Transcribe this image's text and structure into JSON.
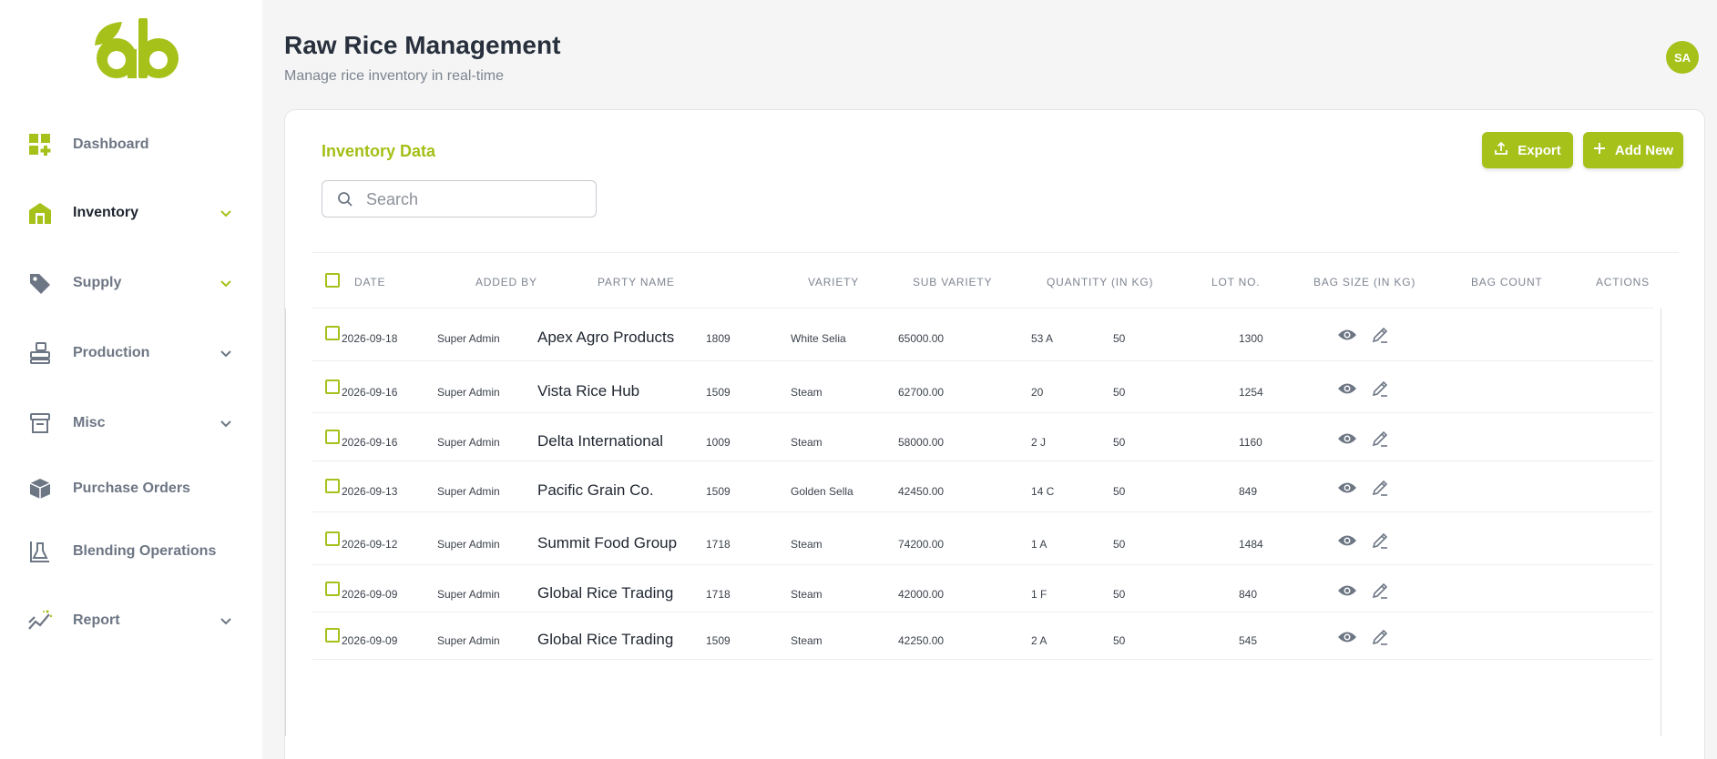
{
  "colors": {
    "accent": "#a6c11a",
    "accent_text": "#a4bf17",
    "sidebar_bg": "#ffffff",
    "page_bg": "#f5f5f5"
  },
  "sidebar": {
    "logo_text": "ab",
    "items": [
      {
        "label": "Dashboard",
        "icon": "dashboard-icon",
        "has_chevron": false
      },
      {
        "label": "Inventory",
        "icon": "warehouse-icon",
        "has_chevron": true,
        "active": true
      },
      {
        "label": "Supply",
        "icon": "tag-icon",
        "has_chevron": true
      },
      {
        "label": "Production",
        "icon": "machine-icon",
        "has_chevron": true
      },
      {
        "label": "Misc",
        "icon": "box-icon",
        "has_chevron": true
      },
      {
        "label": "Purchase Orders",
        "icon": "cube-icon",
        "has_chevron": false
      },
      {
        "label": "Blending Operations",
        "icon": "flask-icon",
        "has_chevron": false
      },
      {
        "label": "Report",
        "icon": "chart-icon",
        "has_chevron": true
      }
    ]
  },
  "header": {
    "title": "Raw Rice Management",
    "subtitle": "Manage rice inventory in real-time",
    "avatar_initials": "SA"
  },
  "card": {
    "title": "Inventory Data",
    "search_placeholder": "Search",
    "search_value": "",
    "export_label": "Export",
    "add_label": "Add New"
  },
  "table": {
    "columns": [
      "Date",
      "Added By",
      "Party Name",
      "Variety",
      "Sub Variety",
      "Quantity (in KG)",
      "Lot No.",
      "Bag Size (in KG)",
      "Bag Count",
      "Actions"
    ],
    "rows": [
      {
        "date": "2026-09-18",
        "added_by": "Super Admin",
        "party": "Apex Agro Products",
        "variety": "1809",
        "sub_variety": "White Selia",
        "quantity": "65000.00",
        "lot": "53 A",
        "bag_size": "50",
        "bag_count": "1300"
      },
      {
        "date": "2026-09-16",
        "added_by": "Super Admin",
        "party": "Vista Rice Hub",
        "variety": "1509",
        "sub_variety": "Steam",
        "quantity": "62700.00",
        "lot": "20",
        "bag_size": "50",
        "bag_count": "1254"
      },
      {
        "date": "2026-09-16",
        "added_by": "Super Admin",
        "party": "Delta International",
        "variety": "1009",
        "sub_variety": "Steam",
        "quantity": "58000.00",
        "lot": "2 J",
        "bag_size": "50",
        "bag_count": "1160"
      },
      {
        "date": "2026-09-13",
        "added_by": "Super Admin",
        "party": "Pacific Grain Co.",
        "variety": "1509",
        "sub_variety": "Golden Sella",
        "quantity": "42450.00",
        "lot": "14 C",
        "bag_size": "50",
        "bag_count": "849"
      },
      {
        "date": "2026-09-12",
        "added_by": "Super Admin",
        "party": "Summit Food Group",
        "variety": "1718",
        "sub_variety": "Steam",
        "quantity": "74200.00",
        "lot": "1 A",
        "bag_size": "50",
        "bag_count": "1484"
      },
      {
        "date": "2026-09-09",
        "added_by": "Super Admin",
        "party": "Global Rice Trading",
        "variety": "1718",
        "sub_variety": "Steam",
        "quantity": "42000.00",
        "lot": "1 F",
        "bag_size": "50",
        "bag_count": "840"
      },
      {
        "date": "2026-09-09",
        "added_by": "Super Admin",
        "party": "Global Rice Trading",
        "variety": "1509",
        "sub_variety": "Steam",
        "quantity": "42250.00",
        "lot": "2 A",
        "bag_size": "50",
        "bag_count": "545"
      }
    ]
  }
}
